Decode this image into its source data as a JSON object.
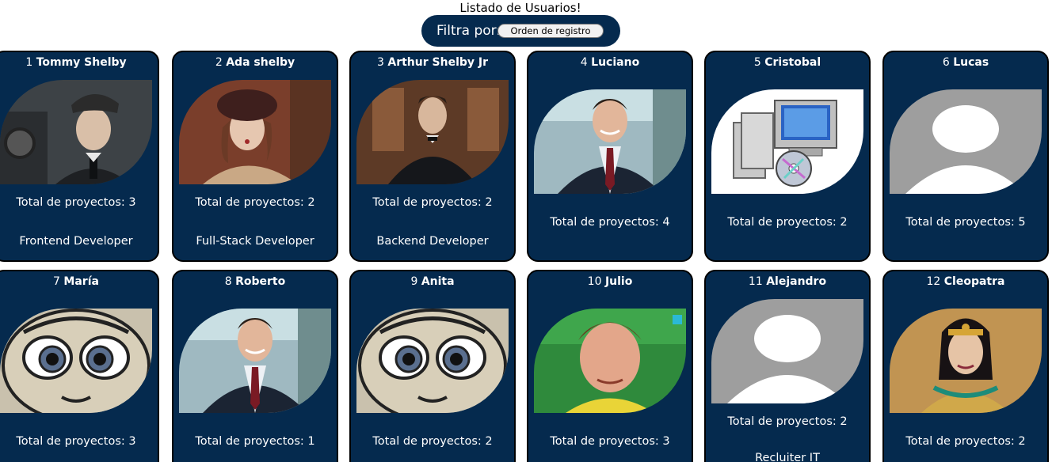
{
  "header": {
    "title": "Listado de Usuarios!"
  },
  "filter": {
    "label": "Filtra por:",
    "selected": "Orden de registro"
  },
  "users": [
    {
      "index": "1",
      "name": "Tommy Shelby",
      "projects": "Total de proyectos: 3",
      "role": "Frontend Developer",
      "avatar": "photo-man-cap"
    },
    {
      "index": "2",
      "name": "Ada shelby",
      "projects": "Total de proyectos: 2",
      "role": "Full-Stack Developer",
      "avatar": "photo-woman-hat"
    },
    {
      "index": "3",
      "name": "Arthur Shelby Jr",
      "projects": "Total de proyectos: 2",
      "role": "Backend Developer",
      "avatar": "photo-man-suit"
    },
    {
      "index": "4",
      "name": "Luciano",
      "projects": "Total de proyectos: 4",
      "role": "",
      "avatar": "photo-man-smiling"
    },
    {
      "index": "5",
      "name": "Cristobal",
      "projects": "Total de proyectos: 2",
      "role": "",
      "avatar": "installer-icon"
    },
    {
      "index": "6",
      "name": "Lucas",
      "projects": "Total de proyectos: 5",
      "role": "",
      "avatar": "default-avatar-icon"
    },
    {
      "index": "7",
      "name": "María",
      "projects": "Total de proyectos: 3",
      "role": "",
      "avatar": "cartoon-girl"
    },
    {
      "index": "8",
      "name": "Roberto",
      "projects": "Total de proyectos: 1",
      "role": "",
      "avatar": "photo-man-smiling"
    },
    {
      "index": "9",
      "name": "Anita",
      "projects": "Total de proyectos: 2",
      "role": "",
      "avatar": "cartoon-girl"
    },
    {
      "index": "10",
      "name": "Julio",
      "projects": "Total de proyectos: 3",
      "role": "",
      "avatar": "photo-footballer"
    },
    {
      "index": "11",
      "name": "Alejandro",
      "projects": "Total de proyectos: 2",
      "role": "Recluiter IT",
      "avatar": "default-avatar-icon"
    },
    {
      "index": "12",
      "name": "Cleopatra",
      "projects": "Total de proyectos: 2",
      "role": "",
      "avatar": "photo-cleopatra"
    }
  ]
}
